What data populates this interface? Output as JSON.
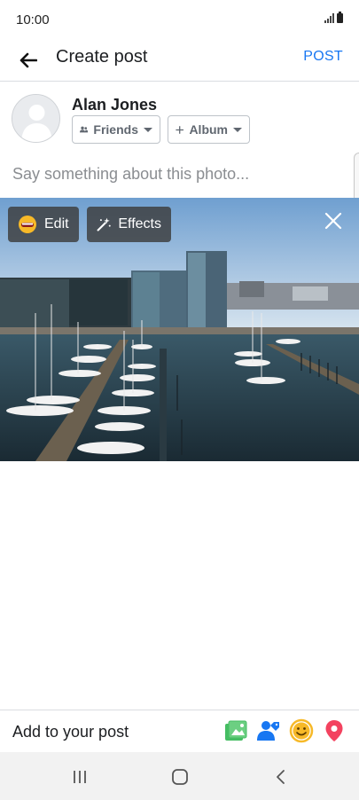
{
  "status_bar": {
    "time": "10:00"
  },
  "header": {
    "title": "Create post",
    "post_label": "POST"
  },
  "user": {
    "name": "Alan Jones"
  },
  "audience": {
    "friends_label": "Friends",
    "album_label": "Album"
  },
  "composer": {
    "placeholder": "Say something about this photo..."
  },
  "photo": {
    "edit_label": "Edit",
    "effects_label": "Effects"
  },
  "add_to_post": {
    "label": "Add to your post",
    "icons": [
      "photo-icon",
      "tag-people-icon",
      "feeling-icon",
      "location-icon"
    ]
  },
  "nav": {
    "icons": [
      "recent-apps-icon",
      "home-icon",
      "back-nav-icon"
    ]
  },
  "colors": {
    "accent": "#1877f2",
    "photo_green": "#45bd62",
    "tag_blue": "#1877f2",
    "feeling_yellow": "#f7b928",
    "location_red": "#f3425f"
  }
}
